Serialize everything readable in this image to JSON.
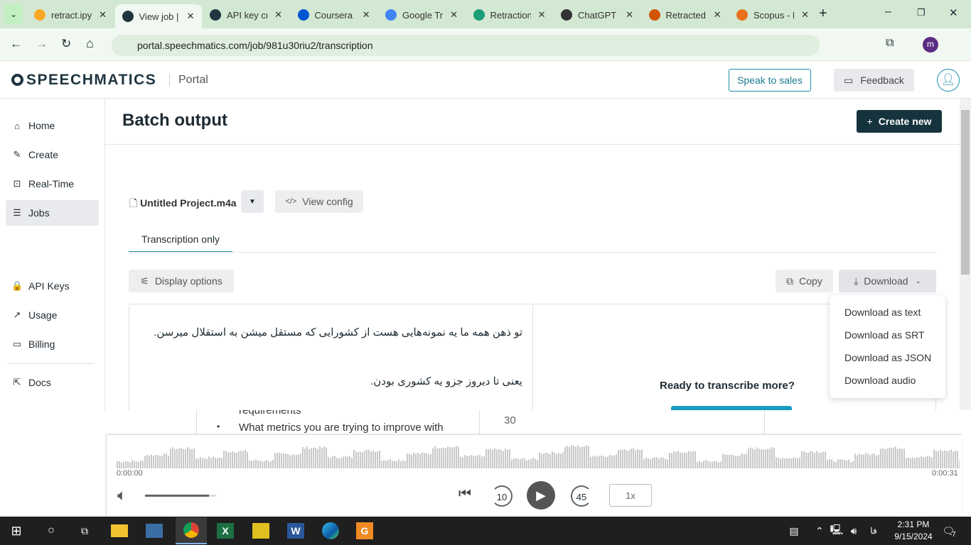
{
  "browser": {
    "tabs": [
      {
        "label": "retract.ipynb",
        "color": "#f9a825"
      },
      {
        "label": "View job | Speechmatics",
        "color": "#1f3540",
        "active": true
      },
      {
        "label": "API key creation",
        "color": "#1f3540"
      },
      {
        "label": "Coursera",
        "color": "#0056d2"
      },
      {
        "label": "Google Translate",
        "color": "#4285f4"
      },
      {
        "label": "Retraction",
        "color": "#1b9e77"
      },
      {
        "label": "ChatGPT",
        "color": "#333333"
      },
      {
        "label": "Retracted",
        "color": "#d35400"
      },
      {
        "label": "Scopus - Document",
        "color": "#e9711c"
      }
    ],
    "url": "portal.speechmatics.com/job/981u30riu2/transcription",
    "profile_initial": "m"
  },
  "header": {
    "logo": "SPEECHMATICS",
    "section": "Portal",
    "speak_to_sales": "Speak to sales",
    "feedback": "Feedback"
  },
  "sidebar": {
    "items": [
      {
        "label": "Home",
        "icon": "⌂"
      },
      {
        "label": "Create",
        "icon": "✎"
      },
      {
        "label": "Real-Time",
        "icon": "⊡"
      },
      {
        "label": "Jobs",
        "icon": "☰",
        "active": true
      },
      {
        "label": "API Keys",
        "icon": "🔒"
      },
      {
        "label": "Usage",
        "icon": "↗"
      },
      {
        "label": "Billing",
        "icon": "▭"
      },
      {
        "label": "Docs",
        "icon": "⇱"
      }
    ]
  },
  "main": {
    "title": "Batch output",
    "create_new": "Create new",
    "file_name": "Untitled Project.m4a",
    "view_config": "View config",
    "tab": "Transcription only",
    "display_options": "Display options",
    "copy": "Copy",
    "download": "Download",
    "download_menu": [
      "Download as text",
      "Download as SRT",
      "Download as JSON",
      "Download audio"
    ],
    "transcript": [
      "تو ذهن همه ما یه نمونه‌هایی هست از کشورایی که مستقل میشن به استقلال میرسن.",
      "یعنی تا دیروز جزو یه کشوری بودن."
    ],
    "ready": "Ready to transcribe more?"
  },
  "overlay": {
    "line1": "requirements",
    "line2": "What metrics you are trying to improve with",
    "number": "30"
  },
  "player": {
    "start": "0:00:00",
    "end": "0:00:31",
    "skip_back": "10",
    "skip_fwd": "45",
    "speed": "1x",
    "volume": 0.9
  },
  "taskbar": {
    "time": "2:31 PM",
    "date": "9/15/2024",
    "lang": "فا",
    "notifications": "7"
  }
}
